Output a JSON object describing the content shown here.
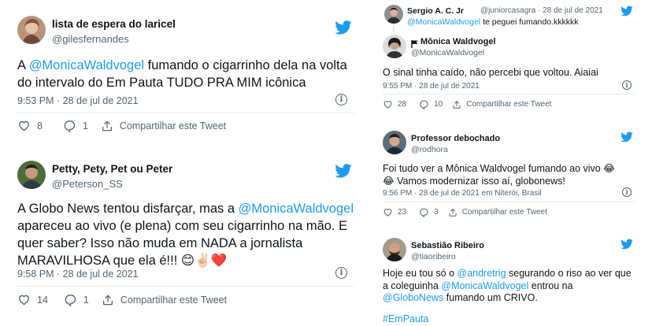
{
  "colors": {
    "accent": "#1d9bf0",
    "text": "#0f1419",
    "muted": "#536471",
    "divider": "#e6ecf0"
  },
  "t1": {
    "name": "lista de espera do laricel",
    "handle": "@gilesfernandes",
    "pre": "A ",
    "mention": "@MonicaWaldvogel",
    "post": " fumando o cigarrinho dela na volta do intervalo do Em Pauta TUDO PRA MIM icônica",
    "meta": "9:53 PM · 28 de jul de 2021",
    "likes": "8",
    "replies": "1",
    "share": "Compartilhar este Tweet"
  },
  "t2": {
    "name": "Petty, Pety, Pet ou Peter",
    "handle": "@Peterson_SS",
    "pre": "A Globo News tentou disfarçar, mas a ",
    "mention": "@MonicaWaldvogel",
    "post": " apareceu ao vivo (e plena) com seu cigarrinho na mão. E quer saber? Isso não muda em NADA a jornalista MARAVILHOSA que ela é!!! 😊✌🏻❤️",
    "meta": "9:58 PM · 28 de jul de 2021",
    "likes": "14",
    "replies": "1",
    "share": "Compartilhar este Tweet"
  },
  "t3": {
    "q_name": "Sergio A. C. Jr",
    "q_handle_date": "@juniorcasagra · 28 de jul de 2021",
    "q_mention": "@MonicaWaldvogel",
    "q_text": " te peguei fumando.kkkkkk",
    "name": "Mônica Waldvogel",
    "handle": "@MonicaWaldvogel",
    "text": "O sinal tinha caído, não percebi que voltou. Aiaiai",
    "meta": "9:55 PM · 28 de jul de 2021",
    "likes": "28",
    "replies": "10",
    "share": "Compartilhar este Tweet"
  },
  "t4": {
    "name": "Professor debochado",
    "handle": "@rodhora",
    "text": "Foi tudo ver a Mônica Waldvogel fumando ao vivo 😂😂 Vamos modernizar isso aí, globonews!",
    "meta": "9:56 PM · 28 de jul de 2021 em Niterói, Brasil",
    "likes": "23",
    "replies": "3",
    "share": "Compartilhar este Tweet"
  },
  "t5": {
    "name": "Sebastião Ribeiro",
    "handle": "@tiaoribeiro",
    "pre": "Hoje eu tou só o ",
    "mention1": "@andretrig",
    "mid": " segurando o riso ao ver que a coleguinha ",
    "mention2": "@MonicaWaldvogel",
    "mid2": " entrou na ",
    "mention3": "@GloboNews",
    "post": " fumando um CRIVO.",
    "hashtag": "#EmPauta"
  },
  "icons": {
    "bird": "twitter-bird-icon",
    "like": "heart-icon",
    "reply": "reply-bubble-icon",
    "share": "share-upload-icon",
    "info": "info-icon",
    "verified": "flag-icon"
  }
}
